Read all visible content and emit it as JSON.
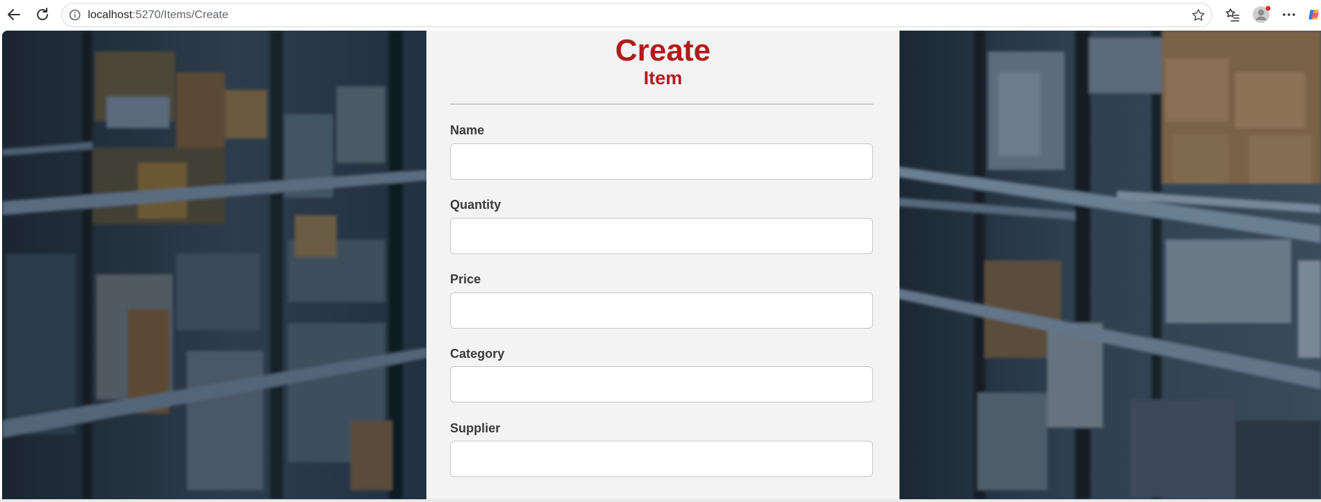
{
  "browser": {
    "url_host": "localhost",
    "url_path": ":5270/Items/Create"
  },
  "icons": {
    "back": "back-arrow-icon",
    "reload": "reload-icon",
    "site_info": "info-icon",
    "favorite": "star-icon",
    "favorites_bar": "favorites-icon",
    "profile": "profile-avatar-icon",
    "menu": "more-icon",
    "copilot": "copilot-icon"
  },
  "colors": {
    "heading": "#b31b1b",
    "panel": "#f3f3f3",
    "background": "#1d2a36"
  },
  "form": {
    "title": "Create",
    "subtitle": "Item",
    "fields": [
      {
        "label": "Name",
        "value": ""
      },
      {
        "label": "Quantity",
        "value": ""
      },
      {
        "label": "Price",
        "value": ""
      },
      {
        "label": "Category",
        "value": ""
      },
      {
        "label": "Supplier",
        "value": ""
      }
    ]
  }
}
